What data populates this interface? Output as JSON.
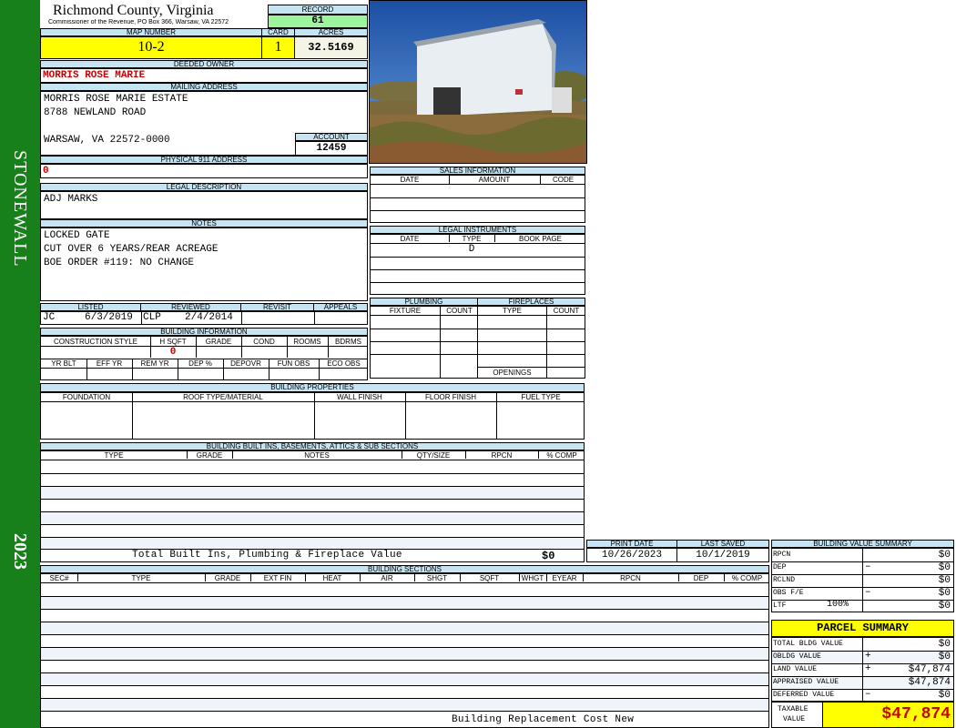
{
  "county": "Richmond County, Virginia",
  "commissioner": "Commissioner of the Revenue, PO Box 366, Warsaw, VA 22572",
  "district": "STONEWALL",
  "year": "2023",
  "record": {
    "label": "RECORD",
    "value": "61"
  },
  "map": {
    "label": "MAP NUMBER",
    "value": "10-2"
  },
  "card": {
    "label": "CARD",
    "value": "1"
  },
  "acres": {
    "label": "ACRES",
    "value": "32.5169"
  },
  "owner": {
    "label": "DEEDED OWNER",
    "value": "MORRIS ROSE MARIE"
  },
  "mailing": {
    "label": "MAILING ADDRESS",
    "line1": "MORRIS ROSE MARIE ESTATE",
    "line2": "8788 NEWLAND ROAD",
    "line3": "WARSAW, VA 22572-0000"
  },
  "account": {
    "label": "ACCOUNT",
    "value": "12459"
  },
  "physical": {
    "label": "PHYSICAL 911 ADDRESS",
    "value": "0"
  },
  "legal": {
    "label": "LEGAL DESCRIPTION",
    "value": "ADJ MARKS"
  },
  "notes": {
    "label": "NOTES",
    "lines": [
      "LOCKED GATE",
      "CUT OVER 6 YEARS/REAR ACREAGE",
      "BOE ORDER #119: NO CHANGE"
    ]
  },
  "status": {
    "listed": "LISTED",
    "reviewed": "REVIEWED",
    "revisit": "REVISIT",
    "appeals": "APPEALS",
    "listed_by": "JC",
    "listed_date": "6/3/2019",
    "reviewed_by": "CLP",
    "reviewed_date": "2/4/2014"
  },
  "building_info": {
    "label": "BUILDING INFORMATION",
    "cols": [
      "CONSTRUCTION STYLE",
      "H SQFT",
      "GRADE",
      "COND",
      "ROOMS",
      "BDRMS"
    ],
    "hsqft": "0",
    "cols2": [
      "YR BLT",
      "EFF YR",
      "REM YR",
      "DEP %",
      "DEPOVR",
      "FUN OBS",
      "ECO OBS"
    ]
  },
  "sales": {
    "label": "SALES INFORMATION",
    "cols": [
      "DATE",
      "AMOUNT",
      "CODE"
    ]
  },
  "legal_instruments": {
    "label": "LEGAL INSTRUMENTS",
    "cols": [
      "DATE",
      "TYPE",
      "BOOK PAGE"
    ],
    "type_value": "D"
  },
  "plumbing": {
    "label": "PLUMBING",
    "cols": [
      "FIXTURE",
      "COUNT"
    ]
  },
  "fireplaces": {
    "label": "FIREPLACES",
    "cols": [
      "TYPE",
      "COUNT"
    ],
    "openings": "OPENINGS"
  },
  "building_properties": {
    "label": "BUILDING PROPERTIES",
    "cols": [
      "FOUNDATION",
      "ROOF TYPE/MATERIAL",
      "WALL FINISH",
      "FLOOR FINISH",
      "FUEL TYPE"
    ]
  },
  "built_ins": {
    "label": "BUILDING BUILT INS, BASEMENTS, ATTICS & SUB SECTIONS",
    "cols": [
      "TYPE",
      "GRADE",
      "NOTES",
      "QTY/SIZE",
      "RPCN",
      "% COMP"
    ],
    "total_label": "Total Built Ins, Plumbing & Fireplace Value",
    "total_value": "$0"
  },
  "print": {
    "print_label": "PRINT DATE",
    "print_date": "10/26/2023",
    "saved_label": "LAST SAVED",
    "saved_date": "10/1/2019"
  },
  "sections": {
    "label": "BUILDING SECTIONS",
    "cols": [
      "SEC#",
      "TYPE",
      "GRADE",
      "EXT FIN",
      "HEAT",
      "AIR",
      "SHGT",
      "SQFT",
      "WHGT",
      "EYEAR",
      "RPCN",
      "DEP",
      "% COMP"
    ],
    "footer": "Building Replacement Cost New"
  },
  "bvs": {
    "label": "BUILDING VALUE SUMMARY",
    "rows": [
      {
        "name": "RPCN",
        "sign": "",
        "pct": "",
        "value": "$0"
      },
      {
        "name": "DEP",
        "sign": "–",
        "pct": "",
        "value": "$0"
      },
      {
        "name": "RCLND",
        "sign": "",
        "pct": "",
        "value": "$0"
      },
      {
        "name": "OBS F/E",
        "sign": "–",
        "pct": "",
        "value": "$0"
      },
      {
        "name": "LTF",
        "sign": "",
        "pct": "100%",
        "value": "$0"
      }
    ]
  },
  "parcel": {
    "label": "PARCEL SUMMARY",
    "rows": [
      {
        "name": "TOTAL BLDG VALUE",
        "sign": "",
        "value": "$0"
      },
      {
        "name": "OBLDG VALUE",
        "sign": "+",
        "value": "$0"
      },
      {
        "name": "LAND VALUE",
        "sign": "+",
        "value": "$47,874"
      },
      {
        "name": "APPRAISED VALUE",
        "sign": "",
        "value": "$47,874"
      },
      {
        "name": "DEFERRED VALUE",
        "sign": "–",
        "value": "$0"
      }
    ],
    "taxable_label1": "TAXABLE",
    "taxable_label2": "VALUE",
    "taxable_value": "$47,874"
  },
  "colors": {
    "green": "#17801a",
    "header": "#c7e4f2",
    "yellow": "#ffff00",
    "recordgreen": "#9cf49c"
  }
}
